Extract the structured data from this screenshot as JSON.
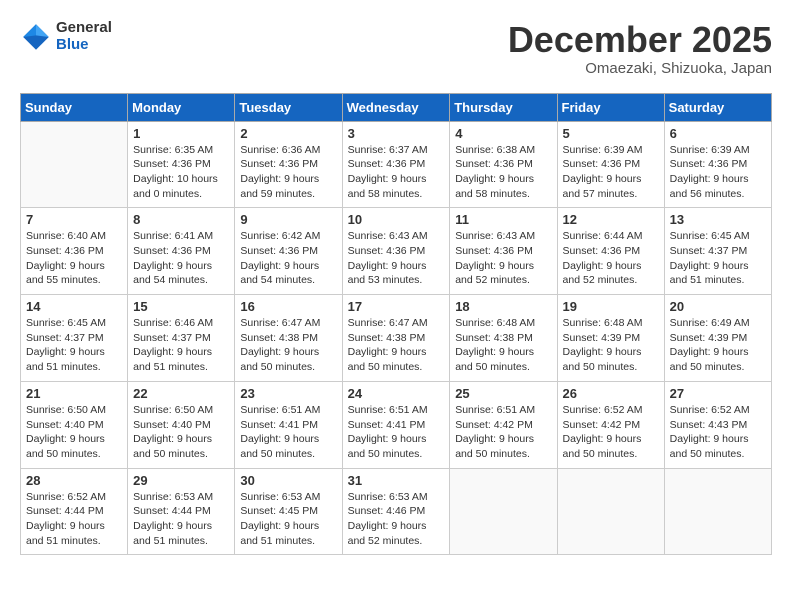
{
  "logo": {
    "general": "General",
    "blue": "Blue"
  },
  "title": "December 2025",
  "location": "Omaezaki, Shizuoka, Japan",
  "days_of_week": [
    "Sunday",
    "Monday",
    "Tuesday",
    "Wednesday",
    "Thursday",
    "Friday",
    "Saturday"
  ],
  "weeks": [
    [
      {
        "day": "",
        "info": ""
      },
      {
        "day": "1",
        "info": "Sunrise: 6:35 AM\nSunset: 4:36 PM\nDaylight: 10 hours\nand 0 minutes."
      },
      {
        "day": "2",
        "info": "Sunrise: 6:36 AM\nSunset: 4:36 PM\nDaylight: 9 hours\nand 59 minutes."
      },
      {
        "day": "3",
        "info": "Sunrise: 6:37 AM\nSunset: 4:36 PM\nDaylight: 9 hours\nand 58 minutes."
      },
      {
        "day": "4",
        "info": "Sunrise: 6:38 AM\nSunset: 4:36 PM\nDaylight: 9 hours\nand 58 minutes."
      },
      {
        "day": "5",
        "info": "Sunrise: 6:39 AM\nSunset: 4:36 PM\nDaylight: 9 hours\nand 57 minutes."
      },
      {
        "day": "6",
        "info": "Sunrise: 6:39 AM\nSunset: 4:36 PM\nDaylight: 9 hours\nand 56 minutes."
      }
    ],
    [
      {
        "day": "7",
        "info": "Sunrise: 6:40 AM\nSunset: 4:36 PM\nDaylight: 9 hours\nand 55 minutes."
      },
      {
        "day": "8",
        "info": "Sunrise: 6:41 AM\nSunset: 4:36 PM\nDaylight: 9 hours\nand 54 minutes."
      },
      {
        "day": "9",
        "info": "Sunrise: 6:42 AM\nSunset: 4:36 PM\nDaylight: 9 hours\nand 54 minutes."
      },
      {
        "day": "10",
        "info": "Sunrise: 6:43 AM\nSunset: 4:36 PM\nDaylight: 9 hours\nand 53 minutes."
      },
      {
        "day": "11",
        "info": "Sunrise: 6:43 AM\nSunset: 4:36 PM\nDaylight: 9 hours\nand 52 minutes."
      },
      {
        "day": "12",
        "info": "Sunrise: 6:44 AM\nSunset: 4:36 PM\nDaylight: 9 hours\nand 52 minutes."
      },
      {
        "day": "13",
        "info": "Sunrise: 6:45 AM\nSunset: 4:37 PM\nDaylight: 9 hours\nand 51 minutes."
      }
    ],
    [
      {
        "day": "14",
        "info": "Sunrise: 6:45 AM\nSunset: 4:37 PM\nDaylight: 9 hours\nand 51 minutes."
      },
      {
        "day": "15",
        "info": "Sunrise: 6:46 AM\nSunset: 4:37 PM\nDaylight: 9 hours\nand 51 minutes."
      },
      {
        "day": "16",
        "info": "Sunrise: 6:47 AM\nSunset: 4:38 PM\nDaylight: 9 hours\nand 50 minutes."
      },
      {
        "day": "17",
        "info": "Sunrise: 6:47 AM\nSunset: 4:38 PM\nDaylight: 9 hours\nand 50 minutes."
      },
      {
        "day": "18",
        "info": "Sunrise: 6:48 AM\nSunset: 4:38 PM\nDaylight: 9 hours\nand 50 minutes."
      },
      {
        "day": "19",
        "info": "Sunrise: 6:48 AM\nSunset: 4:39 PM\nDaylight: 9 hours\nand 50 minutes."
      },
      {
        "day": "20",
        "info": "Sunrise: 6:49 AM\nSunset: 4:39 PM\nDaylight: 9 hours\nand 50 minutes."
      }
    ],
    [
      {
        "day": "21",
        "info": "Sunrise: 6:50 AM\nSunset: 4:40 PM\nDaylight: 9 hours\nand 50 minutes."
      },
      {
        "day": "22",
        "info": "Sunrise: 6:50 AM\nSunset: 4:40 PM\nDaylight: 9 hours\nand 50 minutes."
      },
      {
        "day": "23",
        "info": "Sunrise: 6:51 AM\nSunset: 4:41 PM\nDaylight: 9 hours\nand 50 minutes."
      },
      {
        "day": "24",
        "info": "Sunrise: 6:51 AM\nSunset: 4:41 PM\nDaylight: 9 hours\nand 50 minutes."
      },
      {
        "day": "25",
        "info": "Sunrise: 6:51 AM\nSunset: 4:42 PM\nDaylight: 9 hours\nand 50 minutes."
      },
      {
        "day": "26",
        "info": "Sunrise: 6:52 AM\nSunset: 4:42 PM\nDaylight: 9 hours\nand 50 minutes."
      },
      {
        "day": "27",
        "info": "Sunrise: 6:52 AM\nSunset: 4:43 PM\nDaylight: 9 hours\nand 50 minutes."
      }
    ],
    [
      {
        "day": "28",
        "info": "Sunrise: 6:52 AM\nSunset: 4:44 PM\nDaylight: 9 hours\nand 51 minutes."
      },
      {
        "day": "29",
        "info": "Sunrise: 6:53 AM\nSunset: 4:44 PM\nDaylight: 9 hours\nand 51 minutes."
      },
      {
        "day": "30",
        "info": "Sunrise: 6:53 AM\nSunset: 4:45 PM\nDaylight: 9 hours\nand 51 minutes."
      },
      {
        "day": "31",
        "info": "Sunrise: 6:53 AM\nSunset: 4:46 PM\nDaylight: 9 hours\nand 52 minutes."
      },
      {
        "day": "",
        "info": ""
      },
      {
        "day": "",
        "info": ""
      },
      {
        "day": "",
        "info": ""
      }
    ]
  ]
}
